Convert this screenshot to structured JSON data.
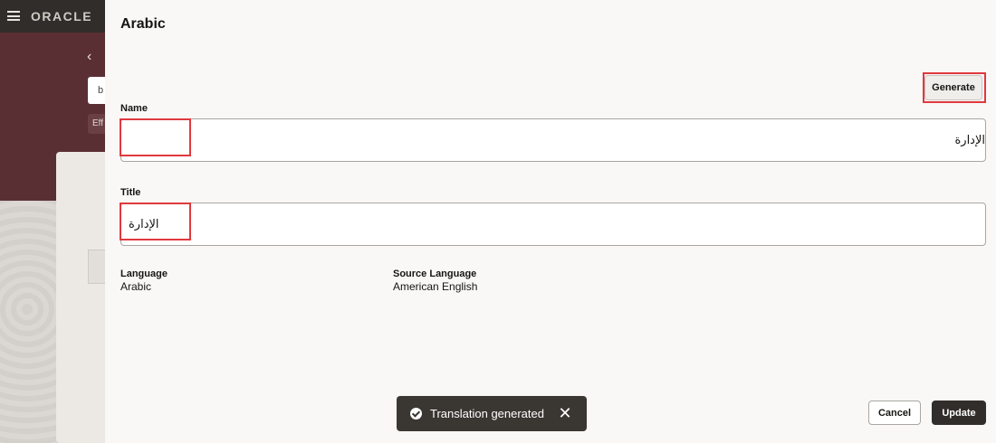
{
  "background_app": {
    "logo": "ORACLE",
    "search_partial": "b",
    "effective_partial": "Eff"
  },
  "drawer": {
    "title": "Arabic",
    "generate_label": "Generate",
    "name": {
      "label": "Name",
      "value": "الإدارة"
    },
    "title_field": {
      "label": "Title",
      "value": "الإدارة"
    },
    "language": {
      "label": "Language",
      "value": "Arabic"
    },
    "source_language": {
      "label": "Source Language",
      "value": "American English"
    },
    "cancel_label": "Cancel",
    "update_label": "Update"
  },
  "toast": {
    "message": "Translation generated",
    "icon": "check-circle-icon",
    "close_icon": "close-icon"
  },
  "colors": {
    "highlight": "#e0393e",
    "banner": "#5a2f33",
    "topbar": "#312d2a",
    "primary_button": "#312d2a"
  }
}
